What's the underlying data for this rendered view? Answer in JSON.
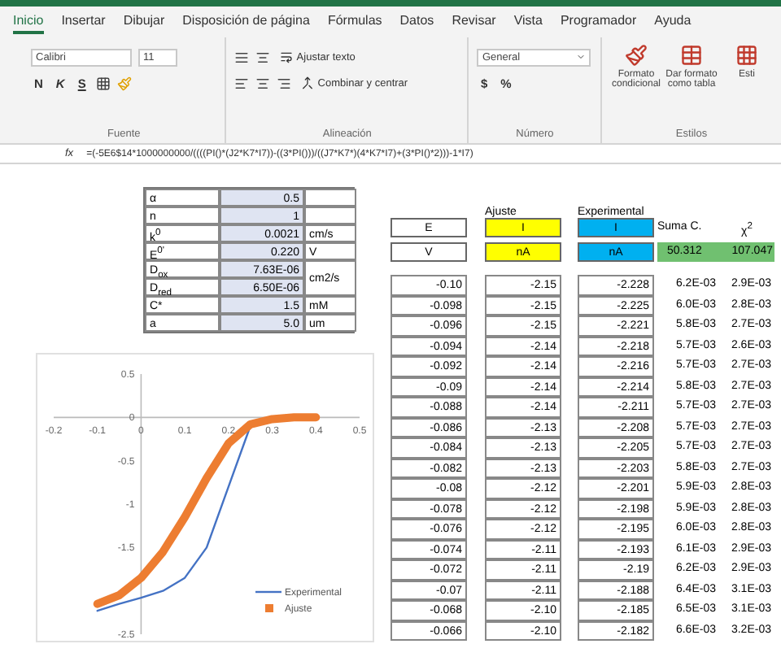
{
  "menu_tabs": [
    {
      "label": "Inicio",
      "selected": true
    },
    {
      "label": "Insertar",
      "selected": false
    },
    {
      "label": "Dibujar",
      "selected": false
    },
    {
      "label": "Disposición de página",
      "selected": false
    },
    {
      "label": "Fórmulas",
      "selected": false
    },
    {
      "label": "Datos",
      "selected": false
    },
    {
      "label": "Revisar",
      "selected": false
    },
    {
      "label": "Vista",
      "selected": false
    },
    {
      "label": "Programador",
      "selected": false
    },
    {
      "label": "Ayuda",
      "selected": false
    }
  ],
  "ribbon": {
    "font_name": "Calibri",
    "font_size": "11",
    "bold": "N",
    "italic": "K",
    "underline": "S",
    "wrap_text": "Ajustar texto",
    "merge": "Combinar y centrar",
    "number_format": "General",
    "currency": "$",
    "percent": "%",
    "styles": [
      {
        "label": "Formato condicional"
      },
      {
        "label": "Dar formato como tabla"
      },
      {
        "label": "Esti"
      }
    ],
    "groups": [
      "Fuente",
      "Alineación",
      "Número",
      "Estilos"
    ]
  },
  "formula_bar": {
    "name_box": "fx",
    "formula": "=(-5E6$14*1000000000/((((PI()*(J2*K7*I7))-((3*PI()))/((J7*K7*)(4*K7*I7)+(3*PI()*2)))-1*I7)"
  },
  "parameters": [
    {
      "name": "α",
      "value": "0.5"
    },
    {
      "name": "n",
      "value": "1"
    },
    {
      "name": "k$^{0}$",
      "value": "0.0021",
      "unit": "cm/s"
    },
    {
      "name": "E$^{0'}$",
      "value": "0.220",
      "unit": "V"
    },
    {
      "name": "D$_{ox}$",
      "value": "7.63E-06",
      "unit": "cm2/s"
    },
    {
      "name": "D$_{red}$",
      "value": "6.50E-06"
    },
    {
      "name": "C*",
      "value": "1.5",
      "unit": "mM"
    },
    {
      "name": "a",
      "value": "5.0",
      "unit": "um"
    }
  ],
  "results": {
    "captions": [
      "Ajuste",
      "Experimental"
    ],
    "headers": [
      {
        "name": "E",
        "unit": "V",
        "color": "#ffffff"
      },
      {
        "name": "I",
        "unit": "nA",
        "color": "#ffff00"
      },
      {
        "name": "I",
        "unit": "nA",
        "color": "#00b0f0"
      }
    ],
    "sum_label": "Suma C.",
    "chi_label": "χ$^{2}$",
    "sum_value": "50.312",
    "chi_value": "107.047",
    "rows": [
      [
        "-0.10",
        "-2.15",
        "-2.228"
      ],
      [
        "-0.098",
        "-2.15",
        "-2.225"
      ],
      [
        "-0.096",
        "-2.15",
        "-2.221"
      ],
      [
        "-0.094",
        "-2.14",
        "-2.218"
      ],
      [
        "-0.092",
        "-2.14",
        "-2.216"
      ],
      [
        "-0.09",
        "-2.14",
        "-2.214"
      ],
      [
        "-0.088",
        "-2.14",
        "-2.211"
      ],
      [
        "-0.086",
        "-2.13",
        "-2.208"
      ],
      [
        "-0.084",
        "-2.13",
        "-2.205"
      ],
      [
        "-0.082",
        "-2.13",
        "-2.203"
      ],
      [
        "-0.08",
        "-2.12",
        "-2.201"
      ],
      [
        "-0.078",
        "-2.12",
        "-2.198"
      ],
      [
        "-0.076",
        "-2.12",
        "-2.195"
      ],
      [
        "-0.074",
        "-2.11",
        "-2.193"
      ],
      [
        "-0.072",
        "-2.11",
        "-2.19"
      ],
      [
        "-0.07",
        "-2.11",
        "-2.188"
      ],
      [
        "-0.068",
        "-2.10",
        "-2.185"
      ],
      [
        "-0.066",
        "-2.10",
        "-2.182"
      ]
    ],
    "terms": [
      [
        "6.2E-03",
        "2.9E-03"
      ],
      [
        "6.0E-03",
        "2.8E-03"
      ],
      [
        "5.8E-03",
        "2.7E-03"
      ],
      [
        "5.7E-03",
        "2.6E-03"
      ],
      [
        "5.7E-03",
        "2.7E-03"
      ],
      [
        "5.8E-03",
        "2.7E-03"
      ],
      [
        "5.7E-03",
        "2.7E-03"
      ],
      [
        "5.7E-03",
        "2.7E-03"
      ],
      [
        "5.7E-03",
        "2.7E-03"
      ],
      [
        "5.8E-03",
        "2.7E-03"
      ],
      [
        "5.9E-03",
        "2.8E-03"
      ],
      [
        "5.9E-03",
        "2.8E-03"
      ],
      [
        "6.0E-03",
        "2.8E-03"
      ],
      [
        "6.1E-03",
        "2.9E-03"
      ],
      [
        "6.2E-03",
        "2.9E-03"
      ],
      [
        "6.4E-03",
        "3.1E-03"
      ],
      [
        "6.5E-03",
        "3.1E-03"
      ],
      [
        "6.6E-03",
        "3.2E-03"
      ]
    ]
  },
  "chart": {
    "chart_data": {
      "type": "line",
      "x": [
        -0.1,
        -0.05,
        0,
        0.05,
        0.1,
        0.15,
        0.2,
        0.25,
        0.3,
        0.35,
        0.4
      ],
      "series": [
        {
          "name": "Experimental",
          "color": "#4472c4",
          "values": [
            -2.23,
            -2.15,
            -2.08,
            -2.0,
            -1.85,
            -1.5,
            -0.8,
            -0.1,
            null,
            null,
            null
          ]
        },
        {
          "name": "Ajuste",
          "color": "#ed7d31",
          "values": [
            -2.15,
            -2.05,
            -1.85,
            -1.55,
            -1.15,
            -0.7,
            -0.3,
            -0.08,
            -0.02,
            0,
            0
          ]
        }
      ],
      "legend": "lower right",
      "xlim": [
        -0.2,
        0.5
      ],
      "ylim": [
        -2.5,
        0.5
      ],
      "xticks": [
        {
          "value": -0.2,
          "label": "-0.2"
        },
        {
          "value": -0.1,
          "label": "-0.1"
        },
        {
          "value": 0,
          "label": "0"
        },
        {
          "value": 0.1,
          "label": "0.1"
        },
        {
          "value": 0.2,
          "label": "0.2"
        },
        {
          "value": 0.3,
          "label": "0.3"
        },
        {
          "value": 0.4,
          "label": "0.4"
        },
        {
          "value": 0.5,
          "label": "0.5"
        }
      ],
      "yticks": [
        {
          "value": 0.5,
          "label": "0.5"
        },
        {
          "value": 0,
          "label": "0"
        },
        {
          "value": -0.5,
          "label": "-0.5"
        },
        {
          "value": -1,
          "label": "-1"
        },
        {
          "value": -1.5,
          "label": "-1.5"
        },
        {
          "value": -2.5,
          "label": "-2.5"
        }
      ]
    }
  }
}
